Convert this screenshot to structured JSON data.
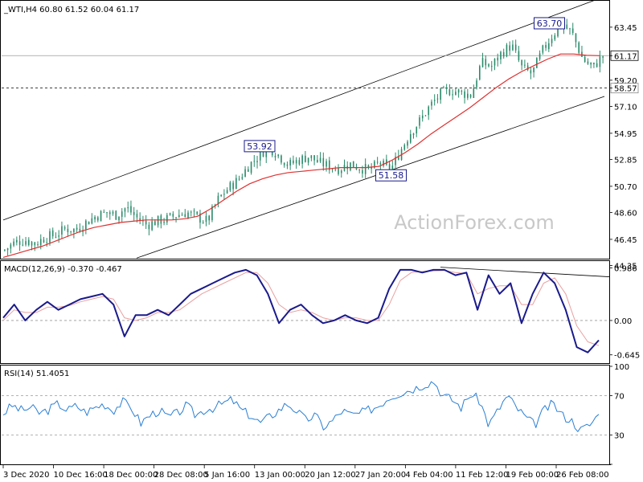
{
  "chart_data": [
    {
      "type": "candlestick",
      "header": "_WTI,H4  60.80 61.52 60.04 61.17",
      "watermark": "ActionForex.com",
      "ylim": [
        44.9,
        65.5
      ],
      "y_ticks": [
        "63.45",
        "61.17",
        "59.20",
        "58.57",
        "57.10",
        "54.95",
        "52.85",
        "50.70",
        "48.60",
        "46.45",
        "44.35"
      ],
      "last_price": {
        "value": 61.17,
        "label": "61.17"
      },
      "horizontal_level": {
        "value": 58.57,
        "label": "58.57",
        "style": "dashed"
      },
      "annotations": [
        {
          "label": "63.70",
          "value": 63.7
        },
        {
          "label": "53.92",
          "value": 53.92
        },
        {
          "label": "51.58",
          "value": 51.58
        }
      ],
      "indicators": [
        {
          "name": "SMA 55",
          "color": "#e03030"
        }
      ],
      "trend_channel": {
        "lower_line": true,
        "upper_line": true
      },
      "candle_close_path": [
        45.6,
        46.2,
        46.4,
        46.1,
        46.6,
        46.8,
        47.3,
        47.2,
        47.8,
        48.3,
        48.6,
        48.4,
        49.0,
        48.2,
        47.6,
        47.9,
        48.1,
        48.4,
        48.6,
        48.2,
        47.9,
        49.6,
        50.5,
        51.2,
        52.3,
        53.1,
        53.9,
        53.2,
        52.4,
        52.8,
        53.1,
        52.6,
        52.3,
        52.1,
        52.5,
        52.2,
        52.0,
        52.6,
        51.9,
        53.5,
        55.0,
        56.0,
        57.2,
        58.1,
        58.4,
        58.2,
        58.0,
        60.6,
        60.3,
        61.4,
        62.0,
        60.2,
        59.7,
        61.5,
        62.8,
        63.7,
        62.9,
        60.9,
        60.2,
        61.17
      ],
      "sma_path": [
        45.0,
        45.3,
        45.6,
        45.9,
        46.3,
        46.7,
        47.1,
        47.4,
        47.6,
        47.8,
        47.9,
        48.0,
        48.0,
        48.0,
        48.1,
        48.3,
        48.9,
        49.6,
        50.3,
        50.9,
        51.3,
        51.6,
        51.8,
        51.9,
        52.0,
        52.1,
        52.2,
        52.2,
        52.2,
        52.3,
        52.8,
        53.4,
        54.1,
        54.9,
        55.6,
        56.3,
        57.0,
        57.8,
        58.6,
        59.3,
        59.9,
        60.4,
        60.9,
        61.3,
        61.3,
        61.2,
        61.17
      ],
      "x_ticks": [
        "3 Dec 2020",
        "10 Dec 16:00",
        "18 Dec 00:00",
        "28 Dec 08:00",
        "5 Jan 16:00",
        "13 Jan 00:00",
        "20 Jan 12:00",
        "27 Jan 20:00",
        "4 Feb 04:00",
        "11 Feb 12:00",
        "19 Feb 00:00",
        "26 Feb 08:00"
      ]
    },
    {
      "type": "line",
      "header": "MACD(12,26,9) -0.370 -0.467",
      "ylim": [
        -0.8,
        1.1
      ],
      "y_ticks": [
        "0.986",
        "0.00",
        "-0.645"
      ],
      "series": [
        {
          "color": "#1a1a8c",
          "values": [
            0.05,
            0.3,
            0.0,
            0.2,
            0.35,
            0.2,
            0.3,
            0.4,
            0.45,
            0.5,
            0.3,
            -0.3,
            0.1,
            0.1,
            0.2,
            0.1,
            0.3,
            0.5,
            0.6,
            0.7,
            0.8,
            0.9,
            0.95,
            0.85,
            0.5,
            -0.05,
            0.2,
            0.3,
            0.1,
            -0.05,
            0.0,
            0.1,
            0.0,
            -0.05,
            0.05,
            0.6,
            0.95,
            0.95,
            0.9,
            0.95,
            0.95,
            0.85,
            0.9,
            0.2,
            0.85,
            0.5,
            0.7,
            -0.05,
            0.5,
            0.9,
            0.7,
            0.2,
            -0.5,
            -0.6,
            -0.37
          ]
        },
        {
          "color": "#e8a0a0",
          "values": [
            0.0,
            0.2,
            0.15,
            0.15,
            0.25,
            0.25,
            0.28,
            0.35,
            0.4,
            0.45,
            0.4,
            0.05,
            0.0,
            0.05,
            0.15,
            0.15,
            0.2,
            0.35,
            0.5,
            0.6,
            0.7,
            0.8,
            0.9,
            0.9,
            0.7,
            0.3,
            0.15,
            0.2,
            0.15,
            0.05,
            0.0,
            0.05,
            0.05,
            0.0,
            0.0,
            0.3,
            0.75,
            0.9,
            0.92,
            0.93,
            0.94,
            0.9,
            0.88,
            0.5,
            0.6,
            0.65,
            0.65,
            0.3,
            0.3,
            0.7,
            0.8,
            0.5,
            -0.1,
            -0.4,
            -0.47
          ]
        }
      ]
    },
    {
      "type": "line",
      "header": "RSI(14) 51.4051",
      "ylim": [
        0,
        100
      ],
      "y_ticks": [
        "100",
        "70",
        "30",
        "0"
      ],
      "series": [
        {
          "color": "#2a7fd4",
          "values": [
            52,
            60,
            55,
            58,
            52,
            56,
            62,
            55,
            60,
            53,
            58,
            62,
            55,
            64,
            58,
            42,
            50,
            55,
            48,
            52,
            60,
            50,
            56,
            58,
            62,
            66,
            55,
            50,
            42,
            48,
            55,
            62,
            55,
            45,
            50,
            38,
            45,
            55,
            50,
            52,
            56,
            60,
            68,
            72,
            75,
            78,
            82,
            85,
            70,
            66,
            58,
            72,
            65,
            40,
            55,
            70,
            58,
            48,
            40,
            55,
            62,
            50,
            45,
            35,
            40,
            51
          ]
        }
      ]
    }
  ]
}
